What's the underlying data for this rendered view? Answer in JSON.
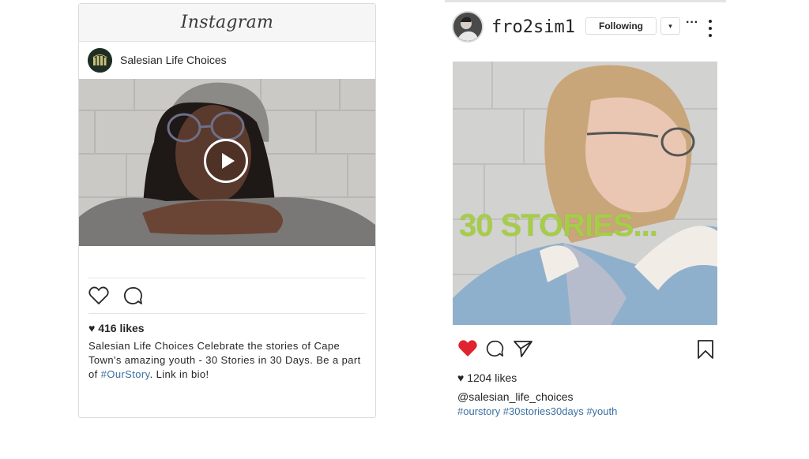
{
  "left_post": {
    "app_title": "Instagram",
    "username": "Salesian Life Choices",
    "likes": "416 likes",
    "caption_user": "Salesian Life Choices",
    "caption_text": "Celebrate the stories of Cape Town's amazing youth - 30 Stories in 30 Days. Be a part of",
    "caption_tag": "#OurStory",
    "caption_end": ". Link in bio!",
    "icons": [
      "heart-outline-icon",
      "comment-icon",
      "play-icon"
    ]
  },
  "right_post": {
    "username": "fro2sim1",
    "follow_label": "Following",
    "dropdown_symbol": "▾",
    "more_symbol": "···",
    "overlay_text": "30 STORIES...",
    "likes": "1204 likes",
    "handle": "@salesian_life_choices",
    "tags": "#ourstory #30stories30days #youth",
    "icons": [
      "heart-filled-icon",
      "comment-icon",
      "share-icon",
      "bookmark-icon"
    ]
  },
  "colors": {
    "heart_red": "#e0242f",
    "link_blue": "#3b6fa0",
    "overlay_green": "#a6cc4a"
  }
}
